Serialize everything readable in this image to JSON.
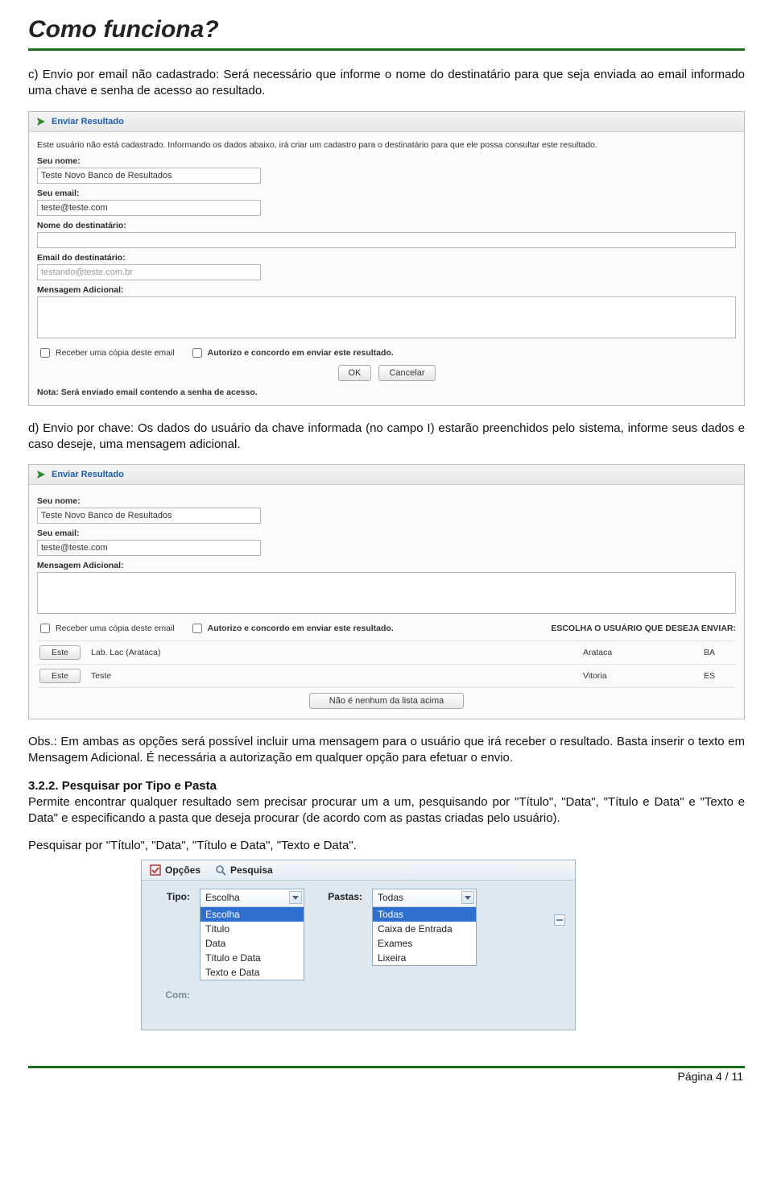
{
  "title": "Como funciona?",
  "para_c": "c) Envio por email não cadastrado: Será necessário que informe o nome do destinatário para que seja enviada ao email informado uma chave e senha de acesso ao resultado.",
  "panel1": {
    "header": "Enviar Resultado",
    "info": "Este usuário não está cadastrado. Informando os dados abaixo, irá criar um cadastro para o destinatário para que ele possa consultar este resultado.",
    "labels": {
      "seu_nome": "Seu nome:",
      "seu_email": "Seu email:",
      "nome_dest": "Nome do destinatário:",
      "email_dest": "Email do destinatário:",
      "msg": "Mensagem Adicional:"
    },
    "values": {
      "seu_nome": "Teste Novo Banco de Resultados",
      "seu_email": "teste@teste.com",
      "nome_dest": "",
      "email_dest_placeholder": "testando@teste.com.br",
      "msg": ""
    },
    "chk1": "Receber uma cópia deste email",
    "chk2": "Autorizo e concordo em enviar este resultado.",
    "btn_ok": "OK",
    "btn_cancel": "Cancelar",
    "nota": "Nota: Será enviado email contendo a senha de acesso."
  },
  "para_d": "d) Envio por chave: Os dados do usuário da chave informada (no campo I) estarão preenchidos pelo sistema, informe seus dados e caso deseje, uma mensagem adicional.",
  "panel2": {
    "header": "Enviar Resultado",
    "labels": {
      "seu_nome": "Seu nome:",
      "seu_email": "Seu email:",
      "msg": "Mensagem Adicional:"
    },
    "values": {
      "seu_nome": "Teste Novo Banco de Resultados",
      "seu_email": "teste@teste.com",
      "msg": ""
    },
    "chk1": "Receber uma cópia deste email",
    "chk2": "Autorizo e concordo em enviar este resultado.",
    "choose_label": "ESCOLHA O USUÁRIO QUE DESEJA ENVIAR:",
    "btn_este": "Este",
    "rows": [
      {
        "name": "Lab. Lac (Arataca)",
        "city": "Arataca",
        "uf": "BA"
      },
      {
        "name": "Teste",
        "city": "Vitoria",
        "uf": "ES"
      }
    ],
    "none_btn": "Não é nenhum da lista acima"
  },
  "obs": "Obs.: Em ambas as opções será possível incluir uma mensagem para o usuário que irá receber o resultado. Basta inserir o texto em Mensagem Adicional. É necessária a autorização em qualquer opção para efetuar o envio.",
  "sec322_title": "3.2.2. Pesquisar por Tipo e Pasta",
  "sec322_body": "Permite encontrar qualquer resultado sem precisar procurar um a um, pesquisando por \"Título\", \"Data\", \"Título e Data\" e \"Texto e Data\" e especificando a pasta que deseja procurar (de acordo com as pastas criadas pelo usuário).",
  "pesq_line": "Pesquisar por \"Título\", \"Data\", \"Título e Data\", \"Texto e Data\".",
  "search": {
    "tab1": "Opções",
    "tab2": "Pesquisa",
    "l_tipo": "Tipo:",
    "l_pastas": "Pastas:",
    "l_com": "Com:",
    "tipo_sel": "Escolha",
    "tipo_opts": [
      "Escolha",
      "Título",
      "Data",
      "Título e Data",
      "Texto e Data"
    ],
    "pastas_sel": "Todas",
    "pastas_opts": [
      "Todas",
      "Caixa de Entrada",
      "Exames",
      "Lixeira"
    ]
  },
  "footer": "Página 4 / 11"
}
